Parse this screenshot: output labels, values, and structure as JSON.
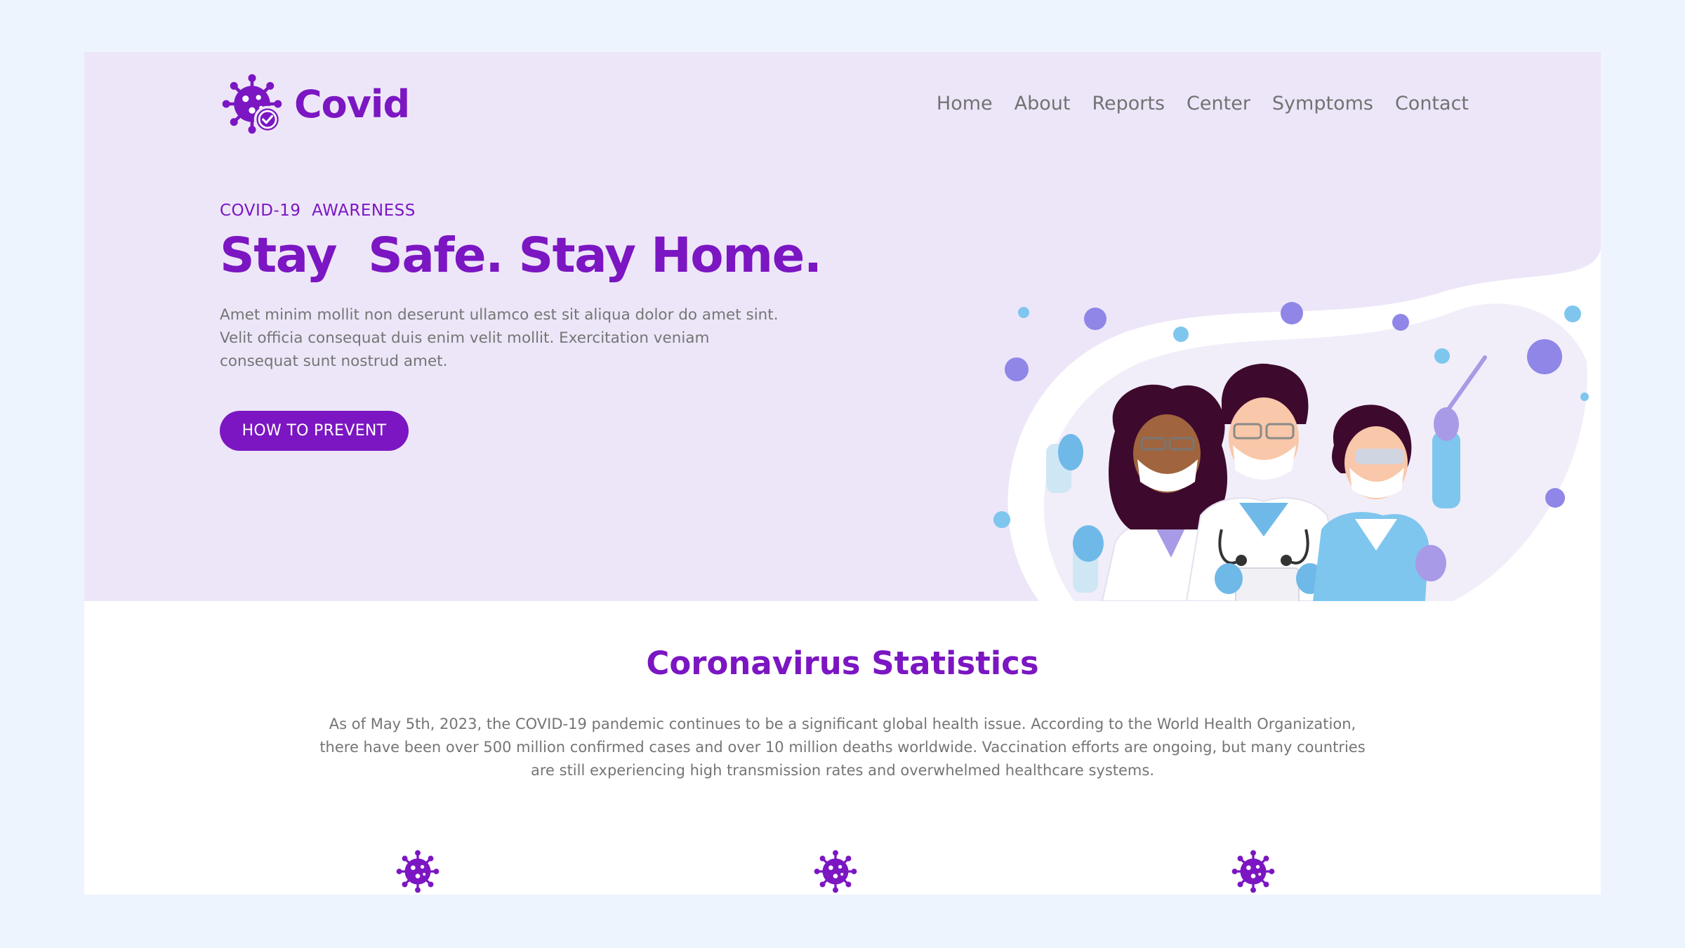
{
  "brand": {
    "name": "Covid",
    "logo_icon": "virus-check-icon",
    "color": "#7b16c2"
  },
  "nav": {
    "items": [
      "Home",
      "About",
      "Reports",
      "Center",
      "Symptoms",
      "Contact"
    ]
  },
  "hero": {
    "eyebrow": "COVID-19  AWARENESS",
    "title": "Stay  Safe. Stay Home.",
    "text": "Amet minim mollit non deserunt ullamco est sit aliqua dolor do amet sint. Velit officia consequat duis enim velit mollit. Exercitation veniam consequat sunt nostrud amet.",
    "cta_label": "HOW TO PREVENT",
    "illustration": "three-doctors-with-masks-illustration"
  },
  "stats": {
    "title": "Coronavirus Statistics",
    "text": "As of May 5th, 2023, the COVID-19 pandemic continues to be a significant global health issue. According to the World Health Organization, there have been over 500 million confirmed cases and over 10 million deaths worldwide. Vaccination efforts are ongoing, but many countries are still experiencing high transmission rates and overwhelmed healthcare systems.",
    "icons": [
      "virus-icon",
      "virus-icon",
      "virus-icon"
    ]
  },
  "colors": {
    "page_bg": "#eef4fe",
    "hero_bg": "#ede6f8",
    "accent": "#7b16c2",
    "body_text": "#757575"
  }
}
